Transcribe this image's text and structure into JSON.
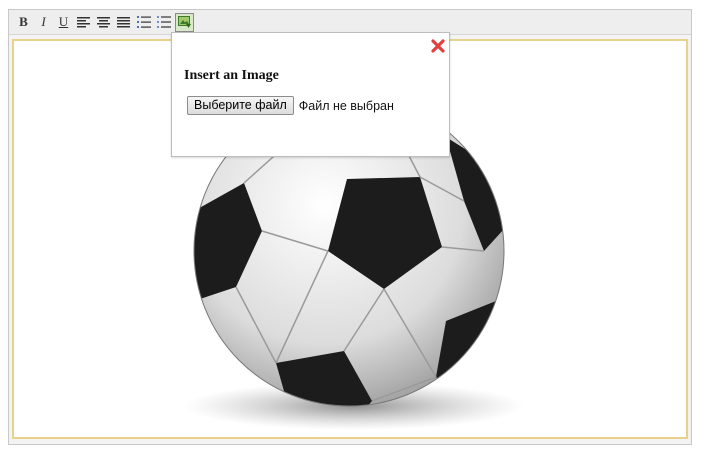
{
  "toolbar": {
    "buttons": [
      {
        "name": "bold-button",
        "label": "B"
      },
      {
        "name": "italic-button",
        "label": "I"
      },
      {
        "name": "underline-button",
        "label": "U"
      }
    ],
    "icons": [
      "align-left-icon",
      "align-center-icon",
      "align-justify-icon",
      "ordered-list-icon",
      "unordered-list-icon",
      "insert-image-icon"
    ]
  },
  "dialog": {
    "title": "Insert an Image",
    "file_button": "Выберите файл",
    "file_status": "Файл не выбран"
  },
  "colors": {
    "content_border": "#e8d18a",
    "close_icon": "#e04040",
    "insert_image_active_bg": "#d9e8c8"
  }
}
